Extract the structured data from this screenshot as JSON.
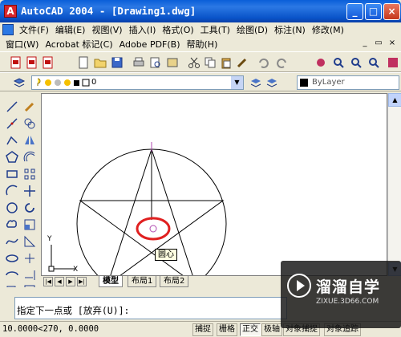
{
  "window": {
    "title": "AutoCAD 2004 - [Drawing1.dwg]",
    "app_icon": "autocad-icon",
    "controls": [
      "minimize",
      "maximize",
      "close"
    ]
  },
  "menubar": {
    "row1": [
      "文件(F)",
      "编辑(E)",
      "视图(V)",
      "插入(I)",
      "格式(O)",
      "工具(T)",
      "绘图(D)",
      "标注(N)",
      "修改(M)"
    ],
    "row2": [
      "窗口(W)",
      "Acrobat 标记(C)",
      "Adobe PDF(B)",
      "帮助(H)"
    ]
  },
  "layer_toolbar": {
    "current_layer": "0",
    "color_value": "ByLayer"
  },
  "drawing": {
    "tooltip": "圆心",
    "ucs_y": "Y",
    "ucs_x": "X"
  },
  "tabs": {
    "items": [
      "模型",
      "布局1",
      "布局2"
    ],
    "active": "模型"
  },
  "command": {
    "prompt": "指定下一点或 [放弃(U)]:"
  },
  "status": {
    "coordinates": "10.0000<270, 0.0000",
    "buttons": [
      "捕捉",
      "栅格",
      "正交",
      "极轴",
      "对象捕捉",
      "对象追踪"
    ]
  },
  "watermark": {
    "name": "溜溜自学",
    "url": "ZIXUE.3D66.COM"
  },
  "colors": {
    "title_blue": "#0a5fd8",
    "highlight_red": "#e02020",
    "crosshair_purple": "#b04ab0"
  }
}
